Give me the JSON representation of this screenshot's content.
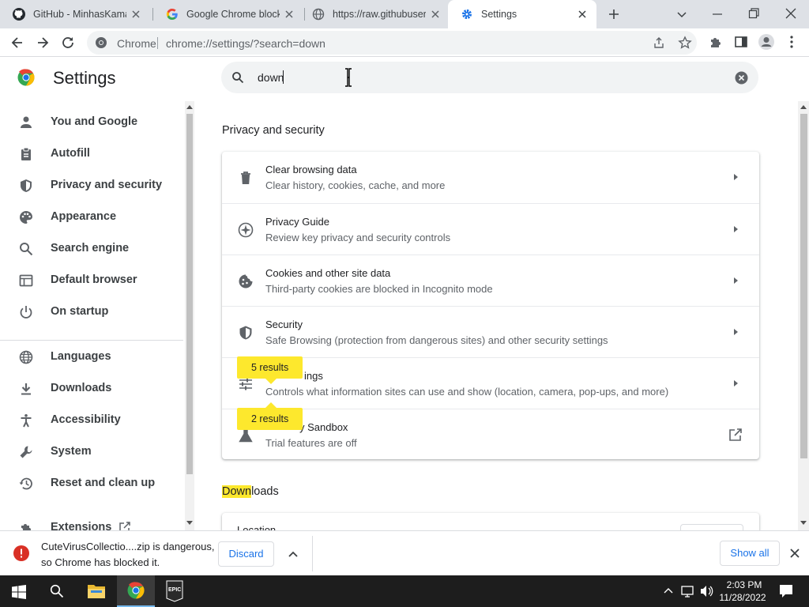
{
  "tabs": [
    {
      "title": "GitHub - MinhasKamal/",
      "icon": "github-icon"
    },
    {
      "title": "Google Chrome blocks",
      "icon": "google-icon"
    },
    {
      "title": "https://raw.githubuserc",
      "icon": "globe-icon"
    },
    {
      "title": "Settings",
      "icon": "settings-gear-icon",
      "active": true
    }
  ],
  "omnibox": {
    "chip": "Chrome",
    "url": "chrome://settings/?search=down"
  },
  "settings": {
    "title": "Settings",
    "search_value": "down",
    "sidebar": [
      {
        "label": "You and Google",
        "icon": "person-icon"
      },
      {
        "label": "Autofill",
        "icon": "clipboard-icon"
      },
      {
        "label": "Privacy and security",
        "icon": "shield-icon"
      },
      {
        "label": "Appearance",
        "icon": "palette-icon"
      },
      {
        "label": "Search engine",
        "icon": "search-icon"
      },
      {
        "label": "Default browser",
        "icon": "browser-icon"
      },
      {
        "label": "On startup",
        "icon": "power-icon"
      },
      {
        "label": "Languages",
        "icon": "globe-icon"
      },
      {
        "label": "Downloads",
        "icon": "download-icon"
      },
      {
        "label": "Accessibility",
        "icon": "accessibility-icon"
      },
      {
        "label": "System",
        "icon": "wrench-icon"
      },
      {
        "label": "Reset and clean up",
        "icon": "history-icon"
      },
      {
        "label": "Extensions",
        "icon": "extension-icon"
      }
    ],
    "section_title": "Privacy and security",
    "rows": [
      {
        "title": "Clear browsing data",
        "subtitle": "Clear history, cookies, cache, and more",
        "icon": "trash-icon"
      },
      {
        "title": "Privacy Guide",
        "subtitle": "Review key privacy and security controls",
        "icon": "compass-icon"
      },
      {
        "title": "Cookies and other site data",
        "subtitle": "Third-party cookies are blocked in Incognito mode",
        "icon": "cookie-icon"
      },
      {
        "title": "Security",
        "subtitle": "Safe Browsing (protection from dangerous sites) and other security settings",
        "icon": "shield-icon"
      },
      {
        "title": "Site Settings",
        "title_visible": "ings",
        "subtitle": "Controls what information sites can use and show (location, camera, pop-ups, and more)",
        "icon": "tune-icon"
      },
      {
        "title": "Privacy Sandbox",
        "title_visible": "y Sandbox",
        "subtitle": "Trial features are off",
        "icon": "flask-icon"
      }
    ],
    "bubbles": [
      "5 results",
      "2 results"
    ],
    "downloads_heading_highlight": "Down",
    "downloads_heading_rest": "loads",
    "downloads_first_row": "Location"
  },
  "download_bar": {
    "line1": "CuteVirusCollectio....zip is dangerous,",
    "line2": "so Chrome has blocked it.",
    "discard": "Discard",
    "show_all": "Show all"
  },
  "taskbar": {
    "time": "2:03 PM",
    "date": "11/28/2022"
  }
}
